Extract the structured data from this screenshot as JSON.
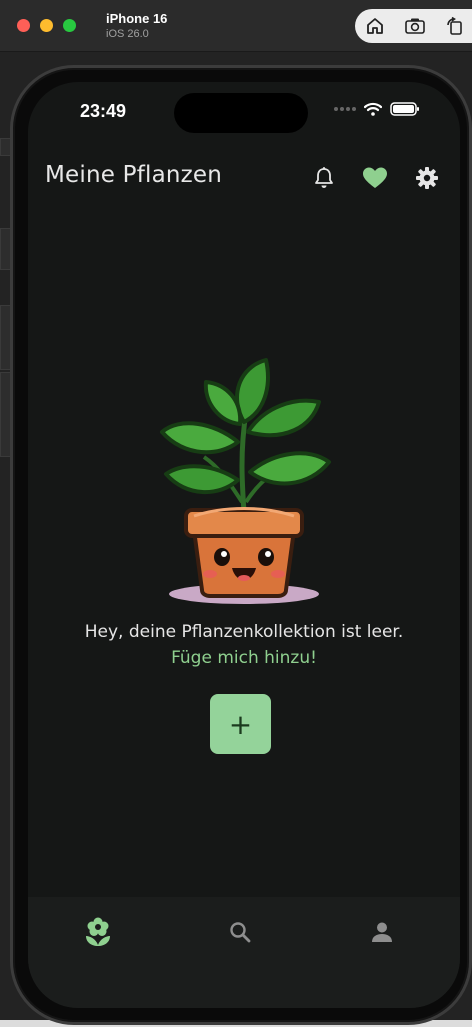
{
  "simulator": {
    "device_name": "iPhone 16",
    "os_version": "iOS 26.0",
    "tools": [
      "home-icon",
      "screenshot-icon",
      "rotate-icon"
    ]
  },
  "status_bar": {
    "time": "23:49",
    "icons": [
      "signal-icon",
      "wifi-icon",
      "battery-icon"
    ]
  },
  "header": {
    "title": "Meine Pflanzen",
    "actions": [
      "bell-icon",
      "heart-icon",
      "gear-icon"
    ]
  },
  "empty_state": {
    "message": "Hey, deine Pflanzenkollektion ist leer.",
    "cta": "Füge mich hinzu!",
    "add_button_label": "+",
    "illustration": "potted-plant-illustration"
  },
  "bottom_nav": {
    "items": [
      {
        "icon": "plant-icon",
        "active": true
      },
      {
        "icon": "search-icon",
        "active": false
      },
      {
        "icon": "person-icon",
        "active": false
      }
    ]
  },
  "colors": {
    "accent": "#8fd08f",
    "button": "#94d39a",
    "background": "#151716",
    "nav_background": "#1b1d1c"
  }
}
